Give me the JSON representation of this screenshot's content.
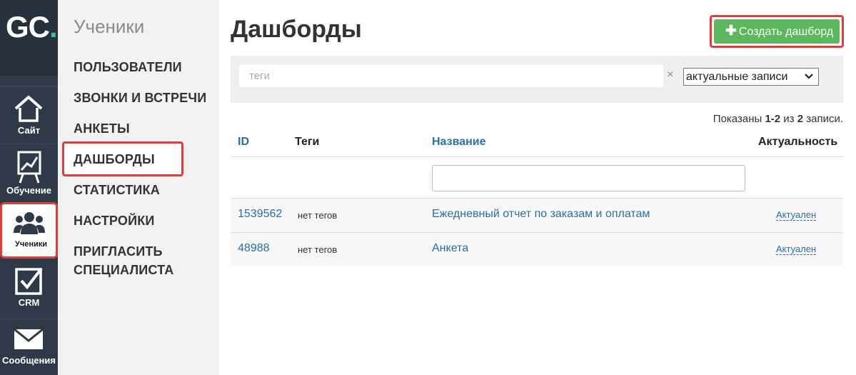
{
  "app": {
    "logo_text": "GC",
    "logo_dot": "."
  },
  "rail": {
    "items": [
      {
        "label": "Сайт",
        "icon": "home-icon"
      },
      {
        "label": "Обучение",
        "icon": "chart-board-icon"
      },
      {
        "label": "Ученики",
        "icon": "users-icon",
        "active": true
      },
      {
        "label": "CRM",
        "icon": "checkbox-icon"
      },
      {
        "label": "Сообщения",
        "icon": "envelope-icon"
      }
    ]
  },
  "sidebar": {
    "title": "Ученики",
    "items": [
      {
        "label": "ПОЛЬЗОВАТЕЛИ"
      },
      {
        "label": "ЗВОНКИ И ВСТРЕЧИ"
      },
      {
        "label": "АНКЕТЫ"
      },
      {
        "label": "ДАШБОРДЫ",
        "active": true
      },
      {
        "label": "СТАТИСТИКА"
      },
      {
        "label": "НАСТРОЙКИ"
      },
      {
        "label": "ПРИГЛАСИТЬ СПЕЦИАЛИСТА",
        "line1": "ПРИГЛАСИТЬ",
        "line2": "СПЕЦИАЛИСТА"
      }
    ]
  },
  "main": {
    "title": "Дашборды",
    "create_button": {
      "plus": "✚",
      "label": "Создать дашборд"
    },
    "filters": {
      "tags_placeholder": "теги",
      "clear_symbol": "×",
      "status_select": "актуальные записи"
    },
    "summary": {
      "prefix": "Показаны ",
      "range": "1-2",
      "middle": " из ",
      "total": "2",
      "suffix": " записи."
    },
    "table": {
      "columns": {
        "id": "ID",
        "tags": "Теги",
        "name": "Название",
        "status": "Актуальность"
      },
      "rows": [
        {
          "id": "1539562",
          "tags": "нет тегов",
          "name": "Ежедневный отчет по заказам и оплатам",
          "status": "Актуален"
        },
        {
          "id": "48988",
          "tags": "нет тегов",
          "name": "Анкета",
          "status": "Актуален"
        }
      ]
    }
  },
  "colors": {
    "accent_green": "#5cb85c",
    "highlight_red": "#d9413a",
    "link_blue": "#2a6fa8",
    "rail_bg": "#2e3a47"
  }
}
